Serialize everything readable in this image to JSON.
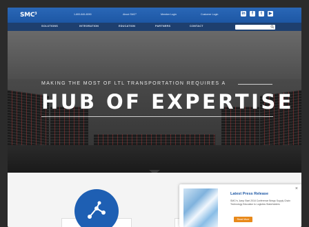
{
  "header": {
    "logo": "SMC",
    "logo_super": "3",
    "links": [
      "1-800-845-8090",
      "About SMC³",
      "Member Login",
      "Customer Login"
    ],
    "social_icons": [
      "linkedin-icon",
      "facebook-icon",
      "twitter-icon",
      "youtube-icon"
    ]
  },
  "nav": {
    "items": [
      "SOLUTIONS",
      "INTEGRATION",
      "EDUCATION",
      "PARTNERS",
      "CONTACT"
    ],
    "search_placeholder": ""
  },
  "hero": {
    "subtitle": "MAKING THE MOST OF LTL TRANSPORTATION REQUIRES A",
    "title": "HUB OF EXPERTISE"
  },
  "press": {
    "title": "Latest Press Release",
    "body": "SMC³'s Jump Start 2016 Conference Brings Supply Chain Technology Education to Logistics Stakeholders",
    "button": "Read More",
    "close": "×"
  },
  "colors": {
    "brand_blue": "#1d57a4",
    "nav_dark": "#1e3f6e",
    "accent_orange": "#e8891a"
  }
}
